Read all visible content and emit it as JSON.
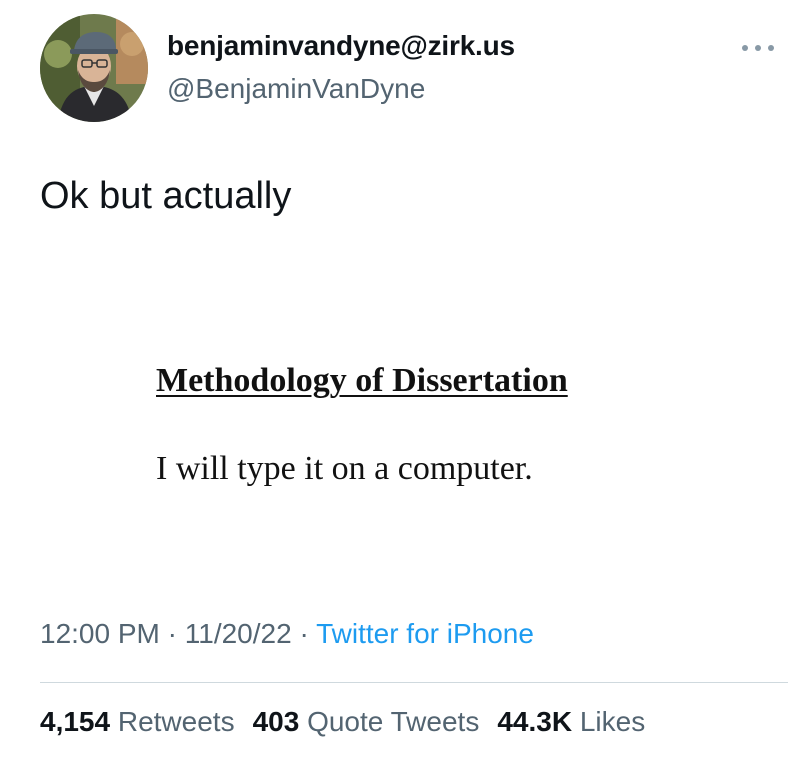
{
  "author": {
    "display_name": "benjaminvandyne@zirk.us",
    "handle": "@BenjaminVanDyne",
    "avatar_icon": "profile-photo"
  },
  "tweet": {
    "text": "Ok but actually",
    "media": {
      "title": "Methodology of Dissertation",
      "body": "I will type it on a computer."
    },
    "time": "12:00 PM",
    "date": "11/20/22",
    "separator": "·",
    "source": "Twitter for iPhone"
  },
  "stats": {
    "retweets_count": "4,154",
    "retweets_label": "Retweets",
    "quotes_count": "403",
    "quotes_label": "Quote Tweets",
    "likes_count": "44.3K",
    "likes_label": "Likes"
  },
  "colors": {
    "text": "#0f1419",
    "secondary": "#536471",
    "link": "#1d9bf0",
    "divider": "#cfd9de"
  },
  "icons": {
    "more": "more-horizontal-icon"
  }
}
